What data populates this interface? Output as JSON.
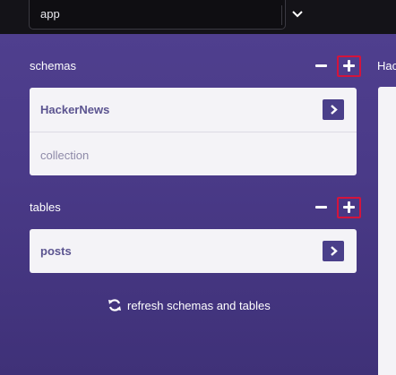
{
  "app_select": {
    "value": "app"
  },
  "schemas": {
    "title": "schemas",
    "items": [
      {
        "label": "HackerNews"
      },
      {
        "label": "collection"
      }
    ]
  },
  "tables": {
    "title": "tables",
    "items": [
      {
        "label": "posts"
      }
    ]
  },
  "refresh": {
    "label": "refresh schemas and tables"
  },
  "right": {
    "title": "Hac"
  },
  "colors": {
    "panel": "#4a3a88",
    "highlight": "#d4143c",
    "card": "#f4f3f7",
    "accent_button": "#4a3f8a"
  },
  "icons": {
    "select": "chevron-down-icon",
    "remove": "minus-icon",
    "add": "plus-icon",
    "open": "chevron-right-icon",
    "refresh": "refresh-icon"
  }
}
